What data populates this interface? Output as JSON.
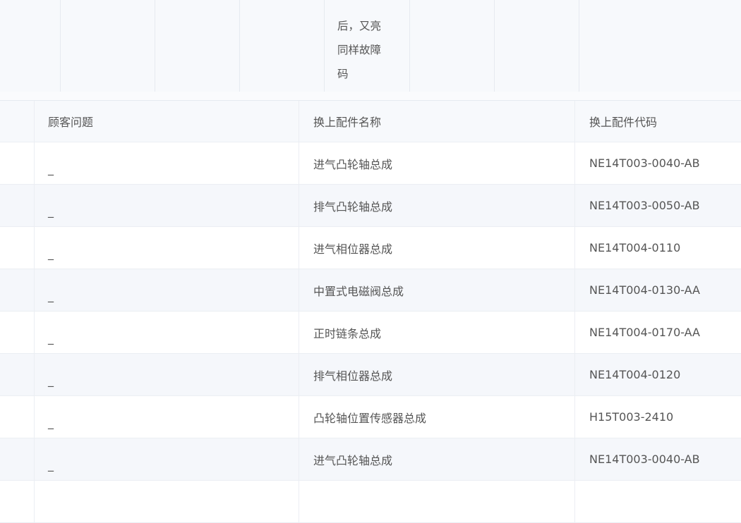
{
  "top_fragment": {
    "lines": [
      "后，又亮",
      "同样故障",
      "码"
    ]
  },
  "table": {
    "columns": [
      "顾客问题",
      "换上配件名称",
      "换上配件代码"
    ],
    "rows": [
      {
        "problem": "_",
        "part_name": "进气凸轮轴总成",
        "part_code": "NE14T003-0040-AB"
      },
      {
        "problem": "_",
        "part_name": "排气凸轮轴总成",
        "part_code": "NE14T003-0050-AB"
      },
      {
        "problem": "_",
        "part_name": "进气相位器总成",
        "part_code": "NE14T004-0110"
      },
      {
        "problem": "_",
        "part_name": "中置式电磁阀总成",
        "part_code": "NE14T004-0130-AA"
      },
      {
        "problem": "_",
        "part_name": "正时链条总成",
        "part_code": "NE14T004-0170-AA"
      },
      {
        "problem": "_",
        "part_name": "排气相位器总成",
        "part_code": "NE14T004-0120"
      },
      {
        "problem": "_",
        "part_name": "凸轮轴位置传感器总成",
        "part_code": "H15T003-2410"
      },
      {
        "problem": "_",
        "part_name": "进气凸轮轴总成",
        "part_code": "NE14T003-0040-AB"
      }
    ]
  }
}
